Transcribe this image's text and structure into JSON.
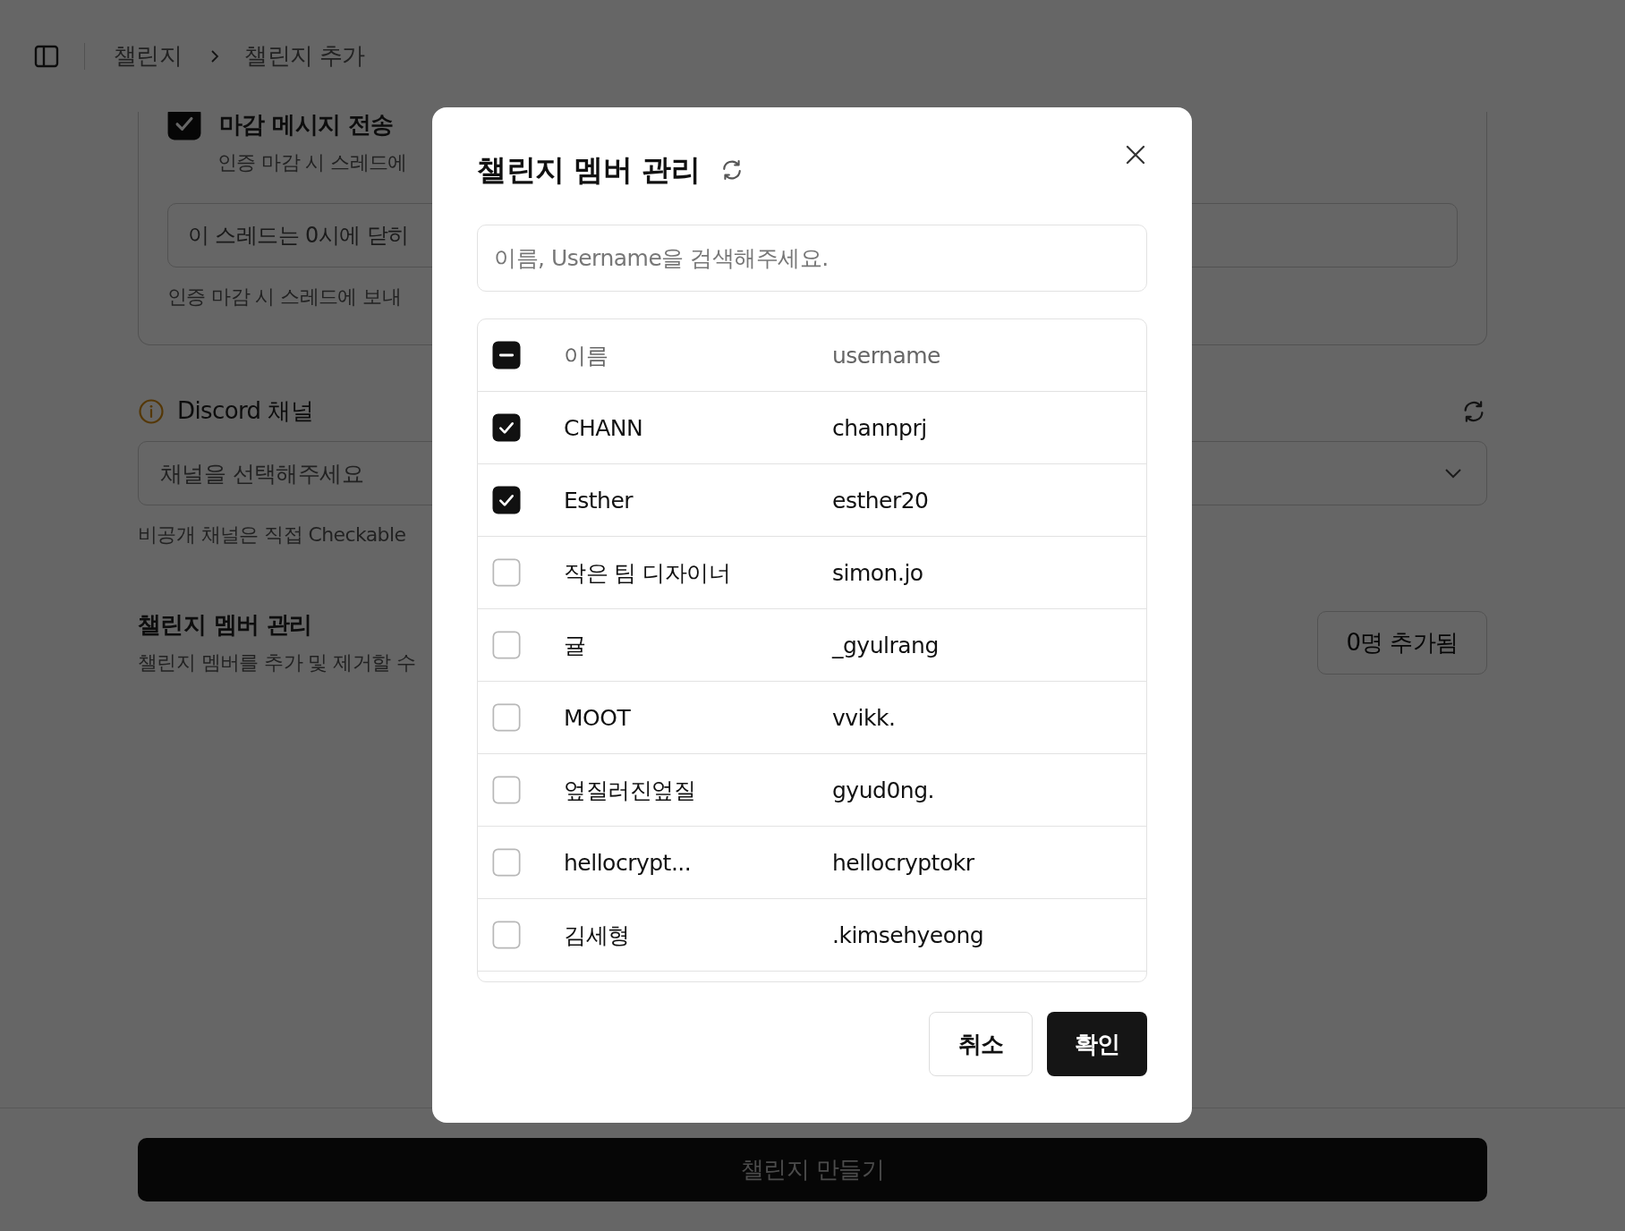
{
  "breadcrumb": [
    {
      "label": "챌린지"
    },
    {
      "label": "챌린지 추가"
    }
  ],
  "form": {
    "closing_message": {
      "checked": true,
      "label": "마감 메시지 전송",
      "description": "인증 마감 시 스레드에",
      "value": "이 스레드는 0시에 닫히",
      "hint": "인증 마감 시 스레드에 보내"
    },
    "discord_channel": {
      "label": "Discord 채널",
      "placeholder": "채널을 선택해주세요",
      "hint": "비공개 채널은 직접 Checkable"
    },
    "members": {
      "title": "챌린지 멤버 관리",
      "description": "챌린지 멤버를 추가 및 제거할 수",
      "button": "0명 추가됨"
    },
    "submit": "챌린지 만들기"
  },
  "modal": {
    "title": "챌린지 멤버 관리",
    "search": {
      "placeholder": "이름, Username을 검색해주세요."
    },
    "table": {
      "select_all": {
        "checked": false,
        "partial": true
      },
      "columns": [
        "이름",
        "username"
      ],
      "rows": [
        {
          "name": "CHANN",
          "username": "channprj",
          "checked": true
        },
        {
          "name": "Esther",
          "username": "esther20",
          "checked": true
        },
        {
          "name": "작은 팀 디자이너",
          "username": "simon.jo",
          "checked": false
        },
        {
          "name": "귤",
          "username": "_gyulrang",
          "checked": false
        },
        {
          "name": "MOOT",
          "username": "vvikk.",
          "checked": false
        },
        {
          "name": "엎질러진엎질",
          "username": "gyud0ng.",
          "checked": false
        },
        {
          "name": "hellocrypt...",
          "username": "hellocryptokr",
          "checked": false
        },
        {
          "name": "김세형",
          "username": ".kimsehyeong",
          "checked": false
        }
      ]
    },
    "buttons": [
      {
        "label": "취소",
        "kind": "secondary"
      },
      {
        "label": "확인",
        "kind": "primary"
      }
    ]
  }
}
